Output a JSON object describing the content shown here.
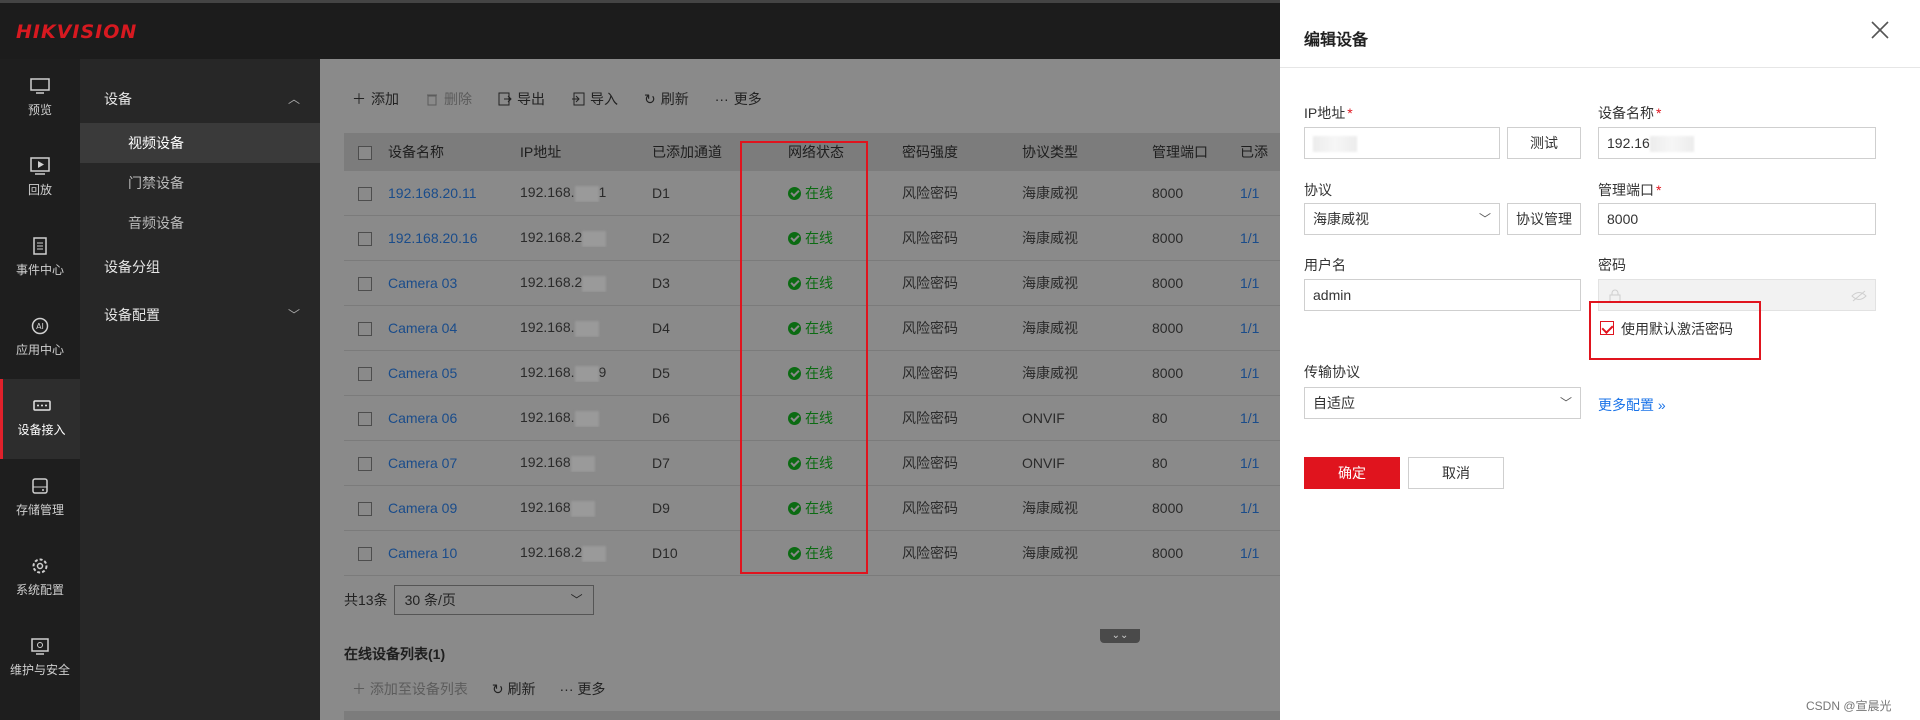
{
  "app": {
    "logo": "HIKVISION"
  },
  "rail": {
    "items": [
      {
        "label": "预览",
        "icon": "monitor-icon"
      },
      {
        "label": "回放",
        "icon": "playback-icon"
      },
      {
        "label": "事件中心",
        "icon": "clipboard-icon"
      },
      {
        "label": "应用中心",
        "icon": "ai-icon"
      },
      {
        "label": "设备接入",
        "icon": "device-icon",
        "active": true
      },
      {
        "label": "存储管理",
        "icon": "storage-icon"
      },
      {
        "label": "系统配置",
        "icon": "gear-icon"
      },
      {
        "label": "维护与安全",
        "icon": "maintenance-icon"
      }
    ]
  },
  "submenu": {
    "group_device": "设备",
    "items": [
      "视频设备",
      "门禁设备",
      "音频设备"
    ],
    "group_device_group": "设备分组",
    "group_device_config": "设备配置"
  },
  "toolbar": {
    "add": "添加",
    "delete": "删除",
    "export": "导出",
    "import": "导入",
    "refresh": "刷新",
    "more": "更多"
  },
  "table": {
    "headers": [
      "设备名称",
      "IP地址",
      "已添加通道",
      "网络状态",
      "密码强度",
      "协议类型",
      "管理端口",
      "已添"
    ],
    "rows": [
      {
        "name": "192.168.20.11",
        "ip": "192.168.",
        "ip_tail": "1",
        "channel": "D1",
        "status": "在线",
        "pw": "风险密码",
        "proto": "海康威视",
        "port": "8000",
        "more": "1/1"
      },
      {
        "name": "192.168.20.16",
        "ip": "192.168.2",
        "ip_tail": "",
        "channel": "D2",
        "status": "在线",
        "pw": "风险密码",
        "proto": "海康威视",
        "port": "8000",
        "more": "1/1"
      },
      {
        "name": "Camera 03",
        "ip": "192.168.2",
        "ip_tail": "",
        "channel": "D3",
        "status": "在线",
        "pw": "风险密码",
        "proto": "海康威视",
        "port": "8000",
        "more": "1/1"
      },
      {
        "name": "Camera 04",
        "ip": "192.168.",
        "ip_tail": "",
        "channel": "D4",
        "status": "在线",
        "pw": "风险密码",
        "proto": "海康威视",
        "port": "8000",
        "more": "1/1"
      },
      {
        "name": "Camera 05",
        "ip": "192.168.",
        "ip_tail": "9",
        "channel": "D5",
        "status": "在线",
        "pw": "风险密码",
        "proto": "海康威视",
        "port": "8000",
        "more": "1/1"
      },
      {
        "name": "Camera 06",
        "ip": "192.168.",
        "ip_tail": "",
        "channel": "D6",
        "status": "在线",
        "pw": "风险密码",
        "proto": "ONVIF",
        "port": "80",
        "more": "1/1"
      },
      {
        "name": "Camera 07",
        "ip": "192.168",
        "ip_tail": "",
        "channel": "D7",
        "status": "在线",
        "pw": "风险密码",
        "proto": "ONVIF",
        "port": "80",
        "more": "1/1"
      },
      {
        "name": "Camera 09",
        "ip": "192.168",
        "ip_tail": "",
        "channel": "D9",
        "status": "在线",
        "pw": "风险密码",
        "proto": "海康威视",
        "port": "8000",
        "more": "1/1"
      },
      {
        "name": "Camera 10",
        "ip": "192.168.2",
        "ip_tail": "",
        "channel": "D10",
        "status": "在线",
        "pw": "风险密码",
        "proto": "海康威视",
        "port": "8000",
        "more": "1/1"
      }
    ]
  },
  "pager": {
    "total": "共13条",
    "page_size": "30 条/页"
  },
  "online_section": {
    "title": "在线设备列表(1)",
    "add_to_list": "添加至设备列表",
    "refresh": "刷新",
    "more": "更多"
  },
  "drawer": {
    "title": "编辑设备",
    "ip_label": "IP地址",
    "ip_value": "",
    "test_btn": "测试",
    "device_name_label": "设备名称",
    "device_name_value": "192.16",
    "protocol_label": "协议",
    "protocol_value": "海康威视",
    "protocol_manage_btn": "协议管理",
    "port_label": "管理端口",
    "port_value": "8000",
    "username_label": "用户名",
    "username_value": "admin",
    "password_label": "密码",
    "default_pw_checkbox": "使用默认激活密码",
    "transport_label": "传输协议",
    "transport_value": "自适应",
    "more_config": "更多配置 »",
    "confirm_btn": "确定",
    "cancel_btn": "取消"
  },
  "watermark": "CSDN @宣晨光",
  "colors": {
    "accent": "#e0141e",
    "online": "#0b6b12",
    "link": "#1a73e8"
  }
}
